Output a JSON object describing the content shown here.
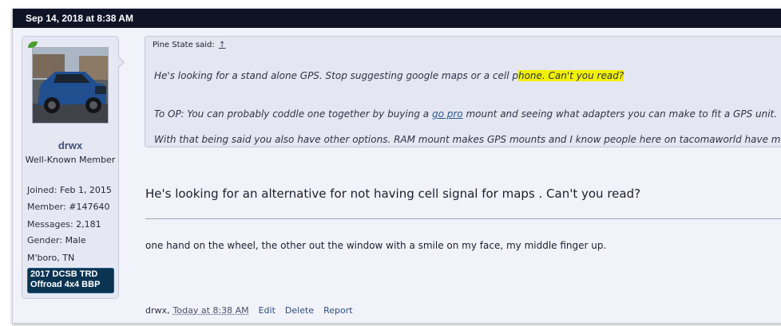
{
  "post": {
    "date": "Sep 14, 2018 at 8:38 AM"
  },
  "user": {
    "name": "drwx",
    "title": "Well-Known Member",
    "stats": [
      {
        "key": "Joined:",
        "value": "Feb 1, 2015"
      },
      {
        "key": "Member:",
        "value": "#147640"
      },
      {
        "key": "Messages:",
        "value": "2,181"
      },
      {
        "key": "Gender:",
        "value": "Male"
      },
      {
        "key": "",
        "value": "M'boro, TN"
      }
    ],
    "banner": "2017 DCSB TRD Offroad 4x4 BBP"
  },
  "quote": {
    "author_label": "Pine State said:",
    "up_arrow": "↑",
    "line1_pre": "He's looking for a stand alone GPS. Stop suggesting google maps or a cell p",
    "line1_hl": "hone. Can't you read?",
    "line2_pre": "To OP: You can probably coddle one together by buying a ",
    "line2_link": "go pro",
    "line2_post": " mount and seeing what adapters you can make to fit a GPS unit.",
    "line3": "With that being said you also have other options. RAM mount makes GPS mounts and I know people here on tacomaworld have m"
  },
  "message": {
    "text": "He's looking for an alternative for not having cell signal for maps . Can't you read?"
  },
  "signature": {
    "text": "one hand on the wheel, the other out the window with a smile on my face, my middle finger up."
  },
  "footer": {
    "author": "drwx,",
    "time": "Today at 8:38 AM",
    "edit": "Edit",
    "delete": "Delete",
    "report": "Report"
  },
  "colors": {
    "header_bg": "#0f1326",
    "highlight": "#f2f000",
    "banner_bg": "#0b3452"
  }
}
